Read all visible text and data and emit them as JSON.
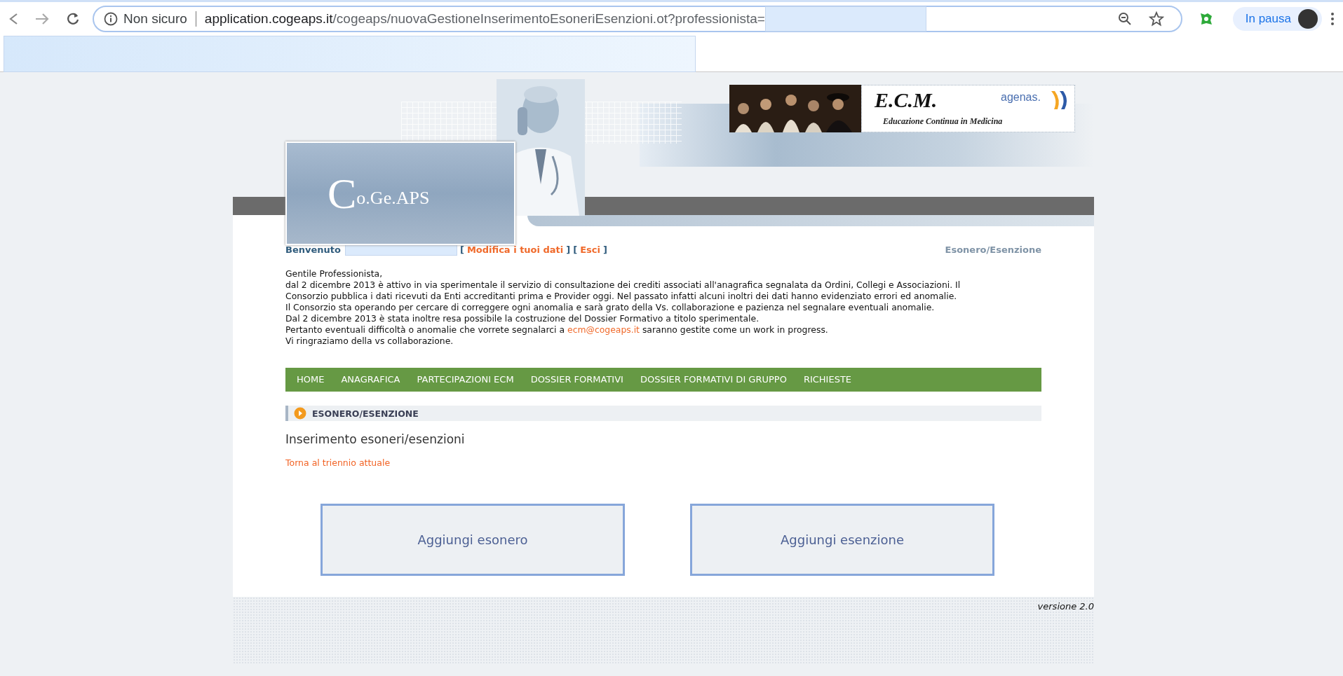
{
  "browser": {
    "security": "Non sicuro",
    "url_host": "application.cogeaps.it",
    "url_path": "/cogeaps/nuovaGestioneInserimentoEsoneriEsenzioni.ot?professionista=",
    "profile": "In pausa"
  },
  "header": {
    "logo_initial": "C",
    "logo_rest": "o.Ge.APS",
    "ecm_title": "E.C.M.",
    "ecm_subtitle": "Educazione Continua in Medicina",
    "agency": "agenas."
  },
  "welcome": {
    "label": "Benvenuto",
    "open": "[",
    "close": "]",
    "links": [
      "Modifica i tuoi dati",
      "Esci"
    ],
    "section": "Esonero/Esenzione"
  },
  "notice": {
    "greeting": "Gentile Professionista,",
    "lines": [
      {
        "kind": "text",
        "text": "dal 2 dicembre 2013 è attivo in via sperimentale il servizio di consultazione dei crediti associati all'anagrafica segnalata da Ordini, Collegi e Associazioni. Il"
      },
      {
        "kind": "text",
        "text": "Consorzio pubblica i dati ricevuti da Enti accreditanti prima e Provider oggi. Nel passato infatti alcuni inoltri dei dati hanno evidenziato errori ed anomalie."
      },
      {
        "kind": "text",
        "text": "Il Consorzio sta operando per cercare di correggere ogni anomalia e sarà grato della Vs. collaborazione e pazienza nel segnalare eventuali anomalie."
      },
      {
        "kind": "text",
        "text": "Dal 2 dicembre 2013 è stata inoltre resa possibile la costruzione del Dossier Formativo a titolo sperimentale."
      },
      {
        "kind": "link",
        "before": "Pertanto eventuali difficoltà o anomalie che vorrete segnalarci a ",
        "link": "ecm@cogeaps.it",
        "after": " saranno gestite come un work in progress."
      },
      {
        "kind": "text",
        "text": "Vi ringraziamo della vs collaborazione."
      }
    ]
  },
  "menu": [
    {
      "label": "HOME",
      "selected": false
    },
    {
      "label": "ANAGRAFICA",
      "selected": false
    },
    {
      "label": "PARTECIPAZIONI ECM",
      "selected": false
    },
    {
      "label": "DOSSIER FORMATIVI",
      "selected": false
    },
    {
      "label": "DOSSIER FORMATIVI DI GRUPPO",
      "selected": false
    },
    {
      "label": "RICHIESTE",
      "selected": false
    }
  ],
  "section": {
    "title": "ESONERO/ESENZIONE"
  },
  "page_title": "Inserimento esoneri/esenzioni",
  "back_link": "Torna al triennio attuale",
  "actions": [
    "Aggiungi esonero",
    "Aggiungi esenzione"
  ],
  "footer": {
    "version": "versione 2.0"
  }
}
